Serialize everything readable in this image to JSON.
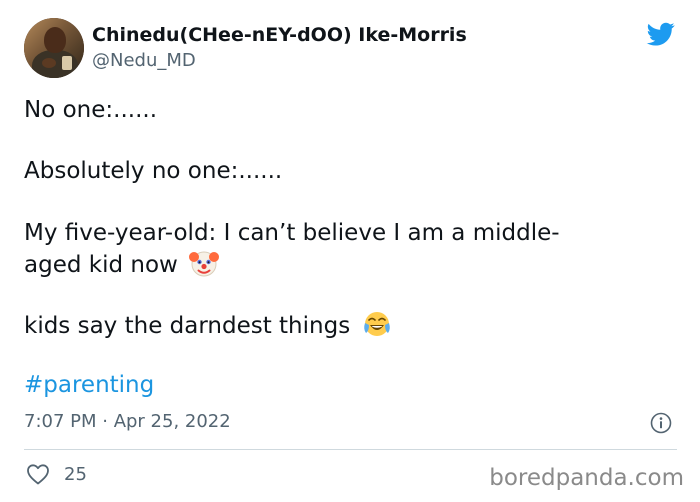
{
  "author": {
    "name": "Chinedu(CHee-nEY-dOO) Ike-Morris",
    "handle": "@Nedu_MD"
  },
  "tweet": {
    "lines": [
      "No one:......",
      "Absolutely no one:......",
      "My five-year-old: I can’t believe I am a middle-",
      "aged kid now",
      "kids say the darndest things"
    ],
    "hashtag": "#parenting",
    "timestamp": "7:07 PM · Apr 25, 2022",
    "likes": "25"
  },
  "icons": {
    "brand": "twitter-bird-icon",
    "avatar": "profile-photo",
    "clown": "clown-face-emoji",
    "laugh": "tears-of-joy-emoji",
    "info": "info-icon",
    "like": "heart-icon"
  },
  "watermark": "boredpanda.com",
  "colors": {
    "twitter_blue": "#1d9bf0",
    "hashtag_blue": "#1b95e0",
    "secondary_text": "#536471",
    "divider": "#cfd9de"
  }
}
